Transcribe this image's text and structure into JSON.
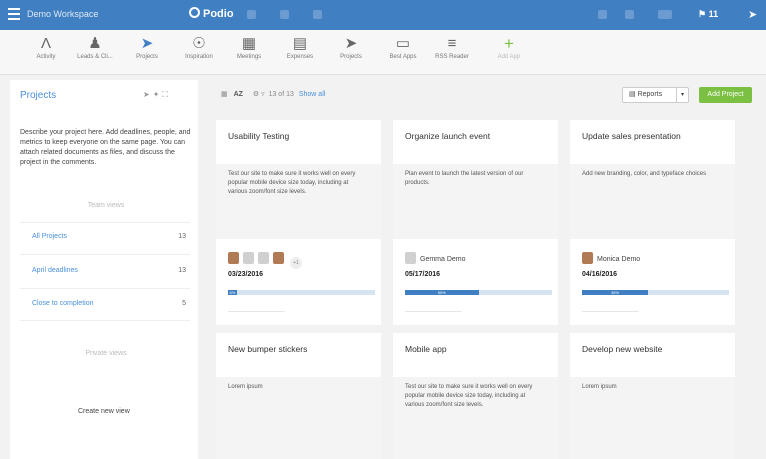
{
  "topbar": {
    "workspace": "Demo Workspace",
    "logo": "Podio",
    "notifications": "11"
  },
  "apps": [
    {
      "label": "Activity",
      "icon": "activity-icon",
      "glyph": "Λ"
    },
    {
      "label": "Leads & Cli...",
      "icon": "person-icon",
      "glyph": "♟"
    },
    {
      "label": "Projects",
      "icon": "paper-plane-icon",
      "glyph": "➤"
    },
    {
      "label": "Inspiration",
      "icon": "lightbulb-icon",
      "glyph": "☉"
    },
    {
      "label": "Meetings",
      "icon": "calendar-icon",
      "glyph": "▦"
    },
    {
      "label": "Expenses",
      "icon": "money-icon",
      "glyph": "▤"
    },
    {
      "label": "Projects",
      "icon": "paper-plane-icon",
      "glyph": "➤"
    },
    {
      "label": "Best Apps",
      "icon": "monitor-icon",
      "glyph": "▭"
    },
    {
      "label": "RSS Reader",
      "icon": "rss-icon",
      "glyph": "≡"
    },
    {
      "label": "Add App",
      "icon": "plus-icon",
      "glyph": "+"
    }
  ],
  "sidebar": {
    "title": "Projects",
    "description": "Describe your project here. Add deadlines, people, and metrics to keep everyone on the same page. You can attach related documents as files, and discuss the project in the comments.",
    "team_views_label": "Team views",
    "views": [
      {
        "label": "All Projects",
        "count": "13"
      },
      {
        "label": "April deadlines",
        "count": "13"
      },
      {
        "label": "Close to completion",
        "count": "5"
      }
    ],
    "private_views_label": "Private views",
    "create_view": "Create new view"
  },
  "toolbar": {
    "sort": "AZ",
    "count": "13 of 13",
    "show_all": "Show all",
    "reports": "Reports",
    "add_project": "Add Project"
  },
  "cards": [
    {
      "title": "Usability Testing",
      "body": "Test our site to make sure it works well on every popular mobile device size today, including at various zoom/font size levels.",
      "person": "",
      "extra": "+1",
      "date": "03/23/2016",
      "progress": 6,
      "progress_label": "6%"
    },
    {
      "title": "Organize launch event",
      "body": "Plan event to launch the latest version of our products.",
      "person": "Gemma Demo",
      "date": "05/17/2016",
      "progress": 50,
      "progress_label": "50%"
    },
    {
      "title": "Update sales presentation",
      "body": "Add new branding, color, and typeface choices",
      "person": "Monica Demo",
      "date": "04/16/2016",
      "progress": 45,
      "progress_label": "45%"
    },
    {
      "title": "New bumper stickers",
      "body": "Lorem ipsum"
    },
    {
      "title": "Mobile app",
      "body": "Test our site to make sure it works well on every popular mobile device size today, including at various zoom/font size levels."
    },
    {
      "title": "Develop new website",
      "body": "Lorem ipsum"
    }
  ],
  "colors": {
    "brand": "#3f7fc2",
    "add_button": "#7bc043",
    "link": "#4a90d9"
  }
}
